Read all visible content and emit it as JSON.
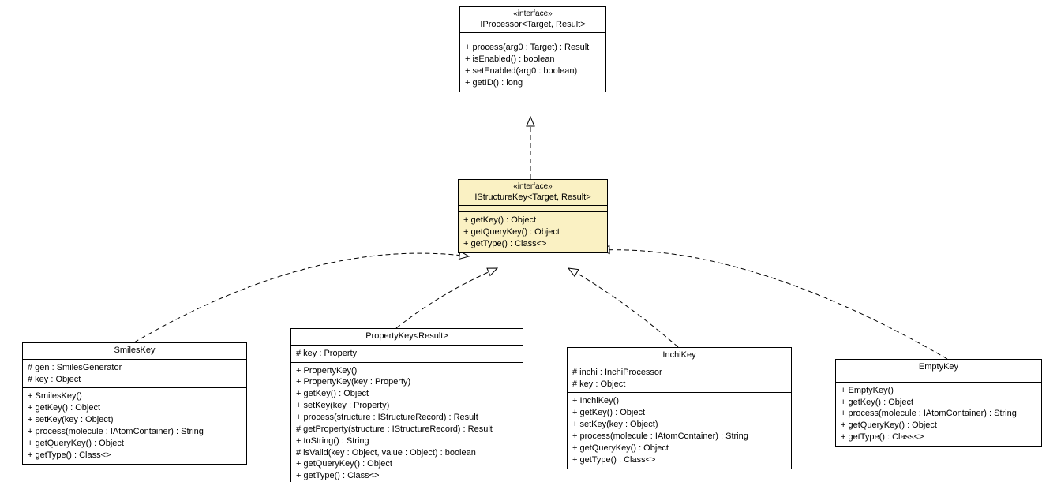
{
  "boxes": {
    "iprocessor": {
      "stereo": "«interface»",
      "name": "IProcessor<Target, Result>",
      "methods": [
        "+ process(arg0 : Target) : Result",
        "+ isEnabled() : boolean",
        "+ setEnabled(arg0 : boolean)",
        "+ getID() : long"
      ]
    },
    "istructurekey": {
      "stereo": "«interface»",
      "name": "IStructureKey<Target, Result>",
      "methods": [
        "+ getKey() : Object",
        "+ getQueryKey() : Object",
        "+ getType() : Class<>"
      ]
    },
    "smileskey": {
      "name": "SmilesKey",
      "fields": [
        "# gen : SmilesGenerator",
        "# key : Object"
      ],
      "methods": [
        "+ SmilesKey()",
        "+ getKey() : Object",
        "+ setKey(key : Object)",
        "+ process(molecule : IAtomContainer) : String",
        "+ getQueryKey() : Object",
        "+ getType() : Class<>"
      ]
    },
    "propertykey": {
      "name": "PropertyKey<Result>",
      "fields": [
        "# key : Property"
      ],
      "methods": [
        "+ PropertyKey()",
        "+ PropertyKey(key : Property)",
        "+ getKey() : Object",
        "+ setKey(key : Property)",
        "+ process(structure : IStructureRecord) : Result",
        "# getProperty(structure : IStructureRecord) : Result",
        "+ toString() : String",
        "# isValid(key : Object, value : Object) : boolean",
        "+ getQueryKey() : Object",
        "+ getType() : Class<>"
      ]
    },
    "inchikey": {
      "name": "InchiKey",
      "fields": [
        "# inchi : InchiProcessor",
        "# key : Object"
      ],
      "methods": [
        "+ InchiKey()",
        "+ getKey() : Object",
        "+ setKey(key : Object)",
        "+ process(molecule : IAtomContainer) : String",
        "+ getQueryKey() : Object",
        "+ getType() : Class<>"
      ]
    },
    "emptykey": {
      "name": "EmptyKey",
      "methods": [
        "+ EmptyKey()",
        "+ getKey() : Object",
        "+ process(molecule : IAtomContainer) : String",
        "+ getQueryKey() : Object",
        "+ getType() : Class<>"
      ]
    }
  }
}
